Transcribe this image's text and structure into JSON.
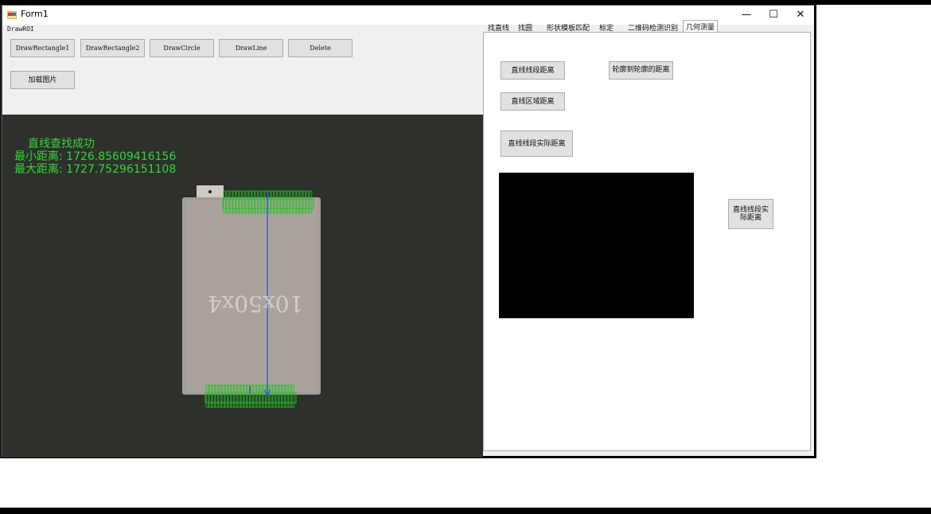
{
  "window": {
    "title": "Form1",
    "controls": {
      "minimize": "—",
      "maximize": "☐",
      "close": "✕"
    }
  },
  "roi_group": {
    "label": "DrawROI",
    "buttons": [
      "DrawRectangle1",
      "DrawRectangle2",
      "DrawCircle",
      "DrawLine",
      "Delete"
    ],
    "load_image": "加载图片"
  },
  "overlay": {
    "line1": "直线查找成功",
    "line2": "最小距离: 1726.85609416156",
    "line3": "最大距离: 1727.75296151108"
  },
  "part_label": "10x50x4",
  "tabs": [
    "找直线",
    "找圆",
    "形状模板匹配",
    "标定",
    "二维码检测识别",
    "几何测量"
  ],
  "active_tab": "几何测量",
  "geometry": {
    "btn_line_dist": "直线线段距离",
    "btn_contour_dist": "轮廓到轮廓的距离",
    "btn_region_dist": "直线区域距离",
    "btn_actual_dist": "直线线段实际距离",
    "btn_actual_dist2": "直线线段实际距离"
  },
  "colors": {
    "overlay": "#33d633",
    "caliper": "#22c022",
    "measure_line": "#2a4be0"
  }
}
